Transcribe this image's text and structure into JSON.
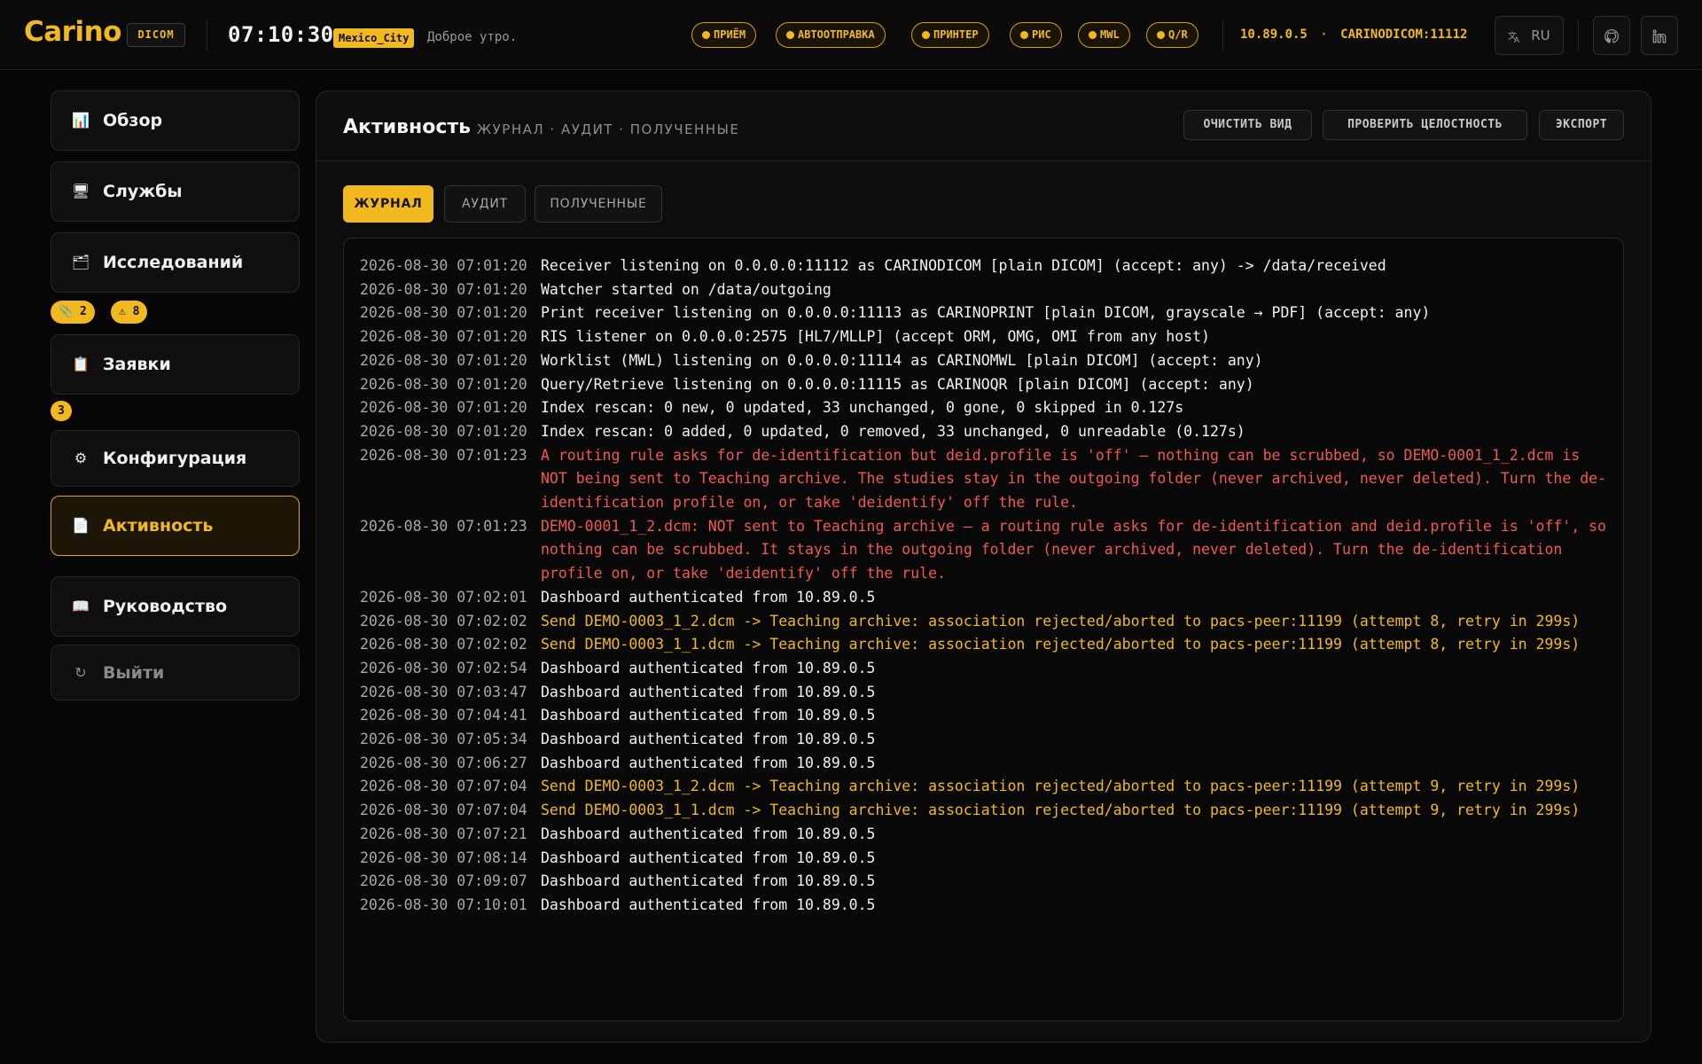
{
  "header": {
    "logo": "Carino",
    "product_tag": "DICOM",
    "clock": "07:10:30",
    "timezone": "Mexico_City",
    "greeting": "Доброе утро.",
    "services": [
      {
        "label": "ПРИЁМ"
      },
      {
        "label": "АВТООТПРАВКА"
      },
      {
        "label": "ПРИНТЕР"
      },
      {
        "label": "РИС"
      },
      {
        "label": "MWL"
      },
      {
        "label": "Q/R"
      }
    ],
    "host_ip": "10.89.0.5",
    "host_separator": "·",
    "host_ae": "CARINODICOM:11112",
    "language": "RU",
    "accent_color": "#f2b91f"
  },
  "sidebar": {
    "items": [
      {
        "label": "Обзор",
        "icon": "chart-icon"
      },
      {
        "label": "Службы",
        "icon": "monitor-icon"
      },
      {
        "label": "Исследований",
        "icon": "folder-icon"
      },
      {
        "label": "Заявки",
        "icon": "clipboard-icon"
      },
      {
        "label": "Конфигурация",
        "icon": "gear-icon"
      },
      {
        "label": "Активность",
        "icon": "document-icon",
        "active": true
      },
      {
        "label": "Руководство",
        "icon": "book-icon"
      },
      {
        "label": "Выйти",
        "icon": "logout-icon"
      }
    ],
    "studies_badges": [
      {
        "icon": "paperclip-icon",
        "count": "2"
      },
      {
        "icon": "warning-icon",
        "count": "8"
      }
    ],
    "orders_badge": "3"
  },
  "main": {
    "title": "Активность",
    "subtitle": "ЖУРНАЛ · АУДИТ · ПОЛУЧЕННЫЕ",
    "actions": {
      "clear": "ОЧИСТИТЬ ВИД",
      "verify": "ПРОВЕРИТЬ ЦЕЛОСТНОСТЬ",
      "export": "ЭКСПОРТ"
    },
    "tabs": [
      {
        "label": "ЖУРНАЛ",
        "active": true
      },
      {
        "label": "АУДИТ"
      },
      {
        "label": "ПОЛУЧЕННЫЕ"
      }
    ],
    "log": [
      {
        "ts": "2026-08-30 07:01:20",
        "level": "info",
        "msg": "Receiver listening on 0.0.0.0:11112 as CARINODICOM [plain DICOM] (accept: any) -> /data/received"
      },
      {
        "ts": "2026-08-30 07:01:20",
        "level": "info",
        "msg": "Watcher started on /data/outgoing"
      },
      {
        "ts": "2026-08-30 07:01:20",
        "level": "info",
        "msg": "Print receiver listening on 0.0.0.0:11113 as CARINOPRINT [plain DICOM, grayscale → PDF] (accept: any)"
      },
      {
        "ts": "2026-08-30 07:01:20",
        "level": "info",
        "msg": "RIS listener on 0.0.0.0:2575 [HL7/MLLP] (accept ORM, OMG, OMI from any host)"
      },
      {
        "ts": "2026-08-30 07:01:20",
        "level": "info",
        "msg": "Worklist (MWL) listening on 0.0.0.0:11114 as CARINOMWL [plain DICOM] (accept: any)"
      },
      {
        "ts": "2026-08-30 07:01:20",
        "level": "info",
        "msg": "Query/Retrieve listening on 0.0.0.0:11115 as CARINOQR [plain DICOM] (accept: any)"
      },
      {
        "ts": "2026-08-30 07:01:20",
        "level": "info",
        "msg": "Index rescan: 0 new, 0 updated, 33 unchanged, 0 gone, 0 skipped in 0.127s"
      },
      {
        "ts": "2026-08-30 07:01:20",
        "level": "info",
        "msg": "Index rescan: 0 added, 0 updated, 0 removed, 33 unchanged, 0 unreadable (0.127s)"
      },
      {
        "ts": "2026-08-30 07:01:23",
        "level": "error",
        "msg": "A routing rule asks for de-identification but deid.profile is 'off' — nothing can be scrubbed, so DEMO-0001_1_2.dcm is NOT being sent to Teaching archive. The studies stay in the outgoing folder (never archived, never deleted). Turn the de-identification profile on, or take 'deidentify' off the rule."
      },
      {
        "ts": "2026-08-30 07:01:23",
        "level": "error",
        "msg": "DEMO-0001_1_2.dcm: NOT sent to Teaching archive — a routing rule asks for de-identification and deid.profile is 'off', so nothing can be scrubbed. It stays in the outgoing folder (never archived, never deleted). Turn the de-identification profile on, or take 'deidentify' off the rule."
      },
      {
        "ts": "2026-08-30 07:02:01",
        "level": "info",
        "msg": "Dashboard authenticated from 10.89.0.5"
      },
      {
        "ts": "2026-08-30 07:02:02",
        "level": "warn",
        "msg": "Send DEMO-0003_1_2.dcm -> Teaching archive: association rejected/aborted to pacs-peer:11199 (attempt 8, retry in 299s)"
      },
      {
        "ts": "2026-08-30 07:02:02",
        "level": "warn",
        "msg": "Send DEMO-0003_1_1.dcm -> Teaching archive: association rejected/aborted to pacs-peer:11199 (attempt 8, retry in 299s)"
      },
      {
        "ts": "2026-08-30 07:02:54",
        "level": "info",
        "msg": "Dashboard authenticated from 10.89.0.5"
      },
      {
        "ts": "2026-08-30 07:03:47",
        "level": "info",
        "msg": "Dashboard authenticated from 10.89.0.5"
      },
      {
        "ts": "2026-08-30 07:04:41",
        "level": "info",
        "msg": "Dashboard authenticated from 10.89.0.5"
      },
      {
        "ts": "2026-08-30 07:05:34",
        "level": "info",
        "msg": "Dashboard authenticated from 10.89.0.5"
      },
      {
        "ts": "2026-08-30 07:06:27",
        "level": "info",
        "msg": "Dashboard authenticated from 10.89.0.5"
      },
      {
        "ts": "2026-08-30 07:07:04",
        "level": "warn",
        "msg": "Send DEMO-0003_1_2.dcm -> Teaching archive: association rejected/aborted to pacs-peer:11199 (attempt 9, retry in 299s)"
      },
      {
        "ts": "2026-08-30 07:07:04",
        "level": "warn",
        "msg": "Send DEMO-0003_1_1.dcm -> Teaching archive: association rejected/aborted to pacs-peer:11199 (attempt 9, retry in 299s)"
      },
      {
        "ts": "2026-08-30 07:07:21",
        "level": "info",
        "msg": "Dashboard authenticated from 10.89.0.5"
      },
      {
        "ts": "2026-08-30 07:08:14",
        "level": "info",
        "msg": "Dashboard authenticated from 10.89.0.5"
      },
      {
        "ts": "2026-08-30 07:09:07",
        "level": "info",
        "msg": "Dashboard authenticated from 10.89.0.5"
      },
      {
        "ts": "2026-08-30 07:10:01",
        "level": "info",
        "msg": "Dashboard authenticated from 10.89.0.5"
      }
    ]
  }
}
